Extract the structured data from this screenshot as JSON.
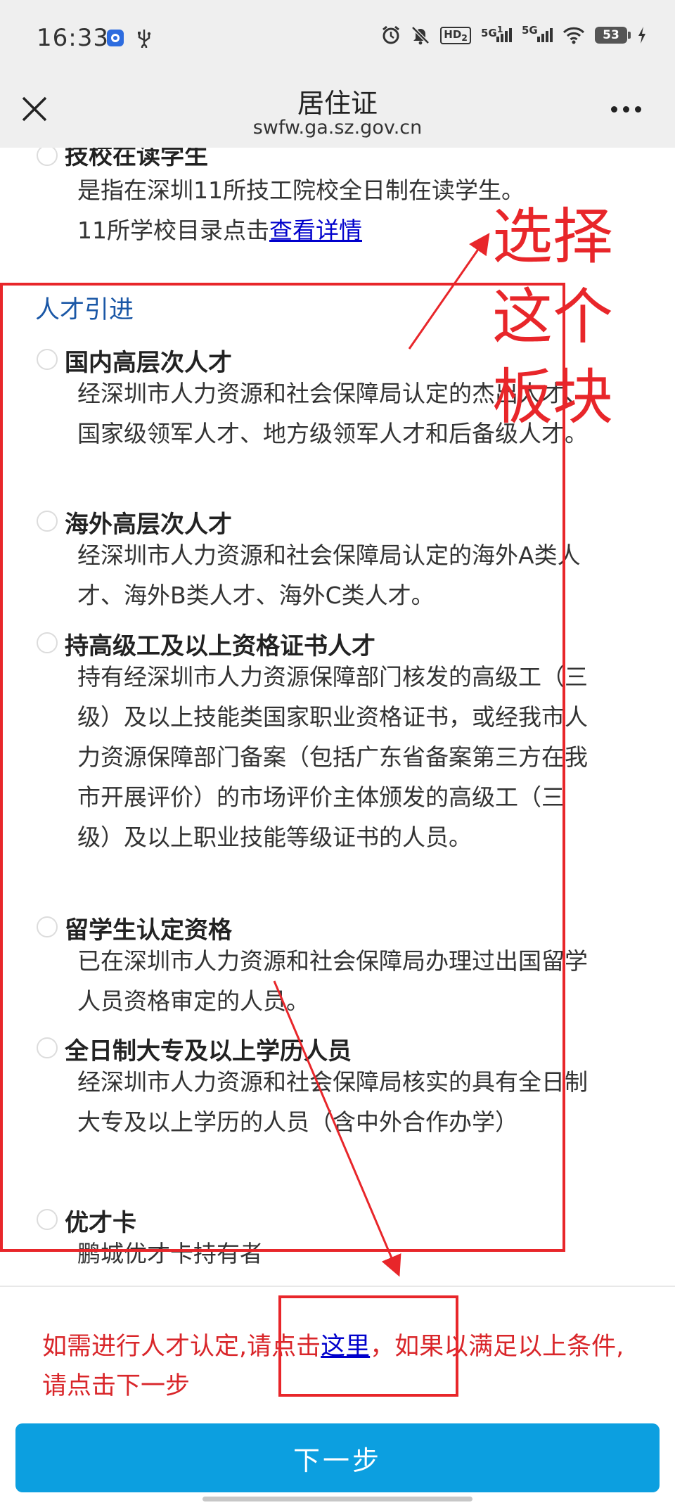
{
  "status_bar": {
    "time": "16:33",
    "icons": [
      "app-icon",
      "usb-icon",
      "alarm-icon",
      "mute-icon",
      "hd-icon",
      "signal-5g-icon",
      "signal-5g-icon",
      "wifi-icon",
      "battery-icon",
      "charging-icon"
    ],
    "hd_label": "HD",
    "hd_sub": "2",
    "net_label_1": "5G",
    "net_label_1_sub": "1",
    "net_label_2": "5G",
    "battery_level": "53"
  },
  "nav": {
    "title": "居住证",
    "subtitle": "swfw.ga.sz.gov.cn"
  },
  "top_option": {
    "title": "技校在读学生",
    "desc_line1": "是指在深圳11所技工院校全日制在读学生。",
    "desc_line2_prefix": "11所学校目录点击",
    "desc_line2_link": "查看详情"
  },
  "section": {
    "title": "人才引进",
    "options": [
      {
        "title": "国内高层次人才",
        "desc": "经深圳市人力资源和社会保障局认定的杰出人才、国家级领军人才、地方级领军人才和后备级人才。"
      },
      {
        "title": "海外高层次人才",
        "desc": "经深圳市人力资源和社会保障局认定的海外A类人才、海外B类人才、海外C类人才。"
      },
      {
        "title": "持高级工及以上资格证书人才",
        "desc": "持有经深圳市人力资源保障部门核发的高级工（三级）及以上技能类国家职业资格证书，或经我市人力资源保障部门备案（包括广东省备案第三方在我市开展评价）的市场评价主体颁发的高级工（三级）及以上职业技能等级证书的人员。"
      },
      {
        "title": "留学生认定资格",
        "desc": "已在深圳市人力资源和社会保障局办理过出国留学人员资格审定的人员。"
      },
      {
        "title": "全日制大专及以上学历人员",
        "desc": "经深圳市人力资源和社会保障局核实的具有全日制大专及以上学历的人员（含中外合作办学）"
      },
      {
        "title": "优才卡",
        "desc": "鹏城优才卡持有者"
      }
    ]
  },
  "notice": {
    "prefix": "如需进行人才认定,请点击",
    "link": "这里",
    "suffix": "，如果以满足以上条件,请点击下一步"
  },
  "next_button": "下一步",
  "annotation": {
    "text": "选择这个板块",
    "color": "#e8262a"
  }
}
